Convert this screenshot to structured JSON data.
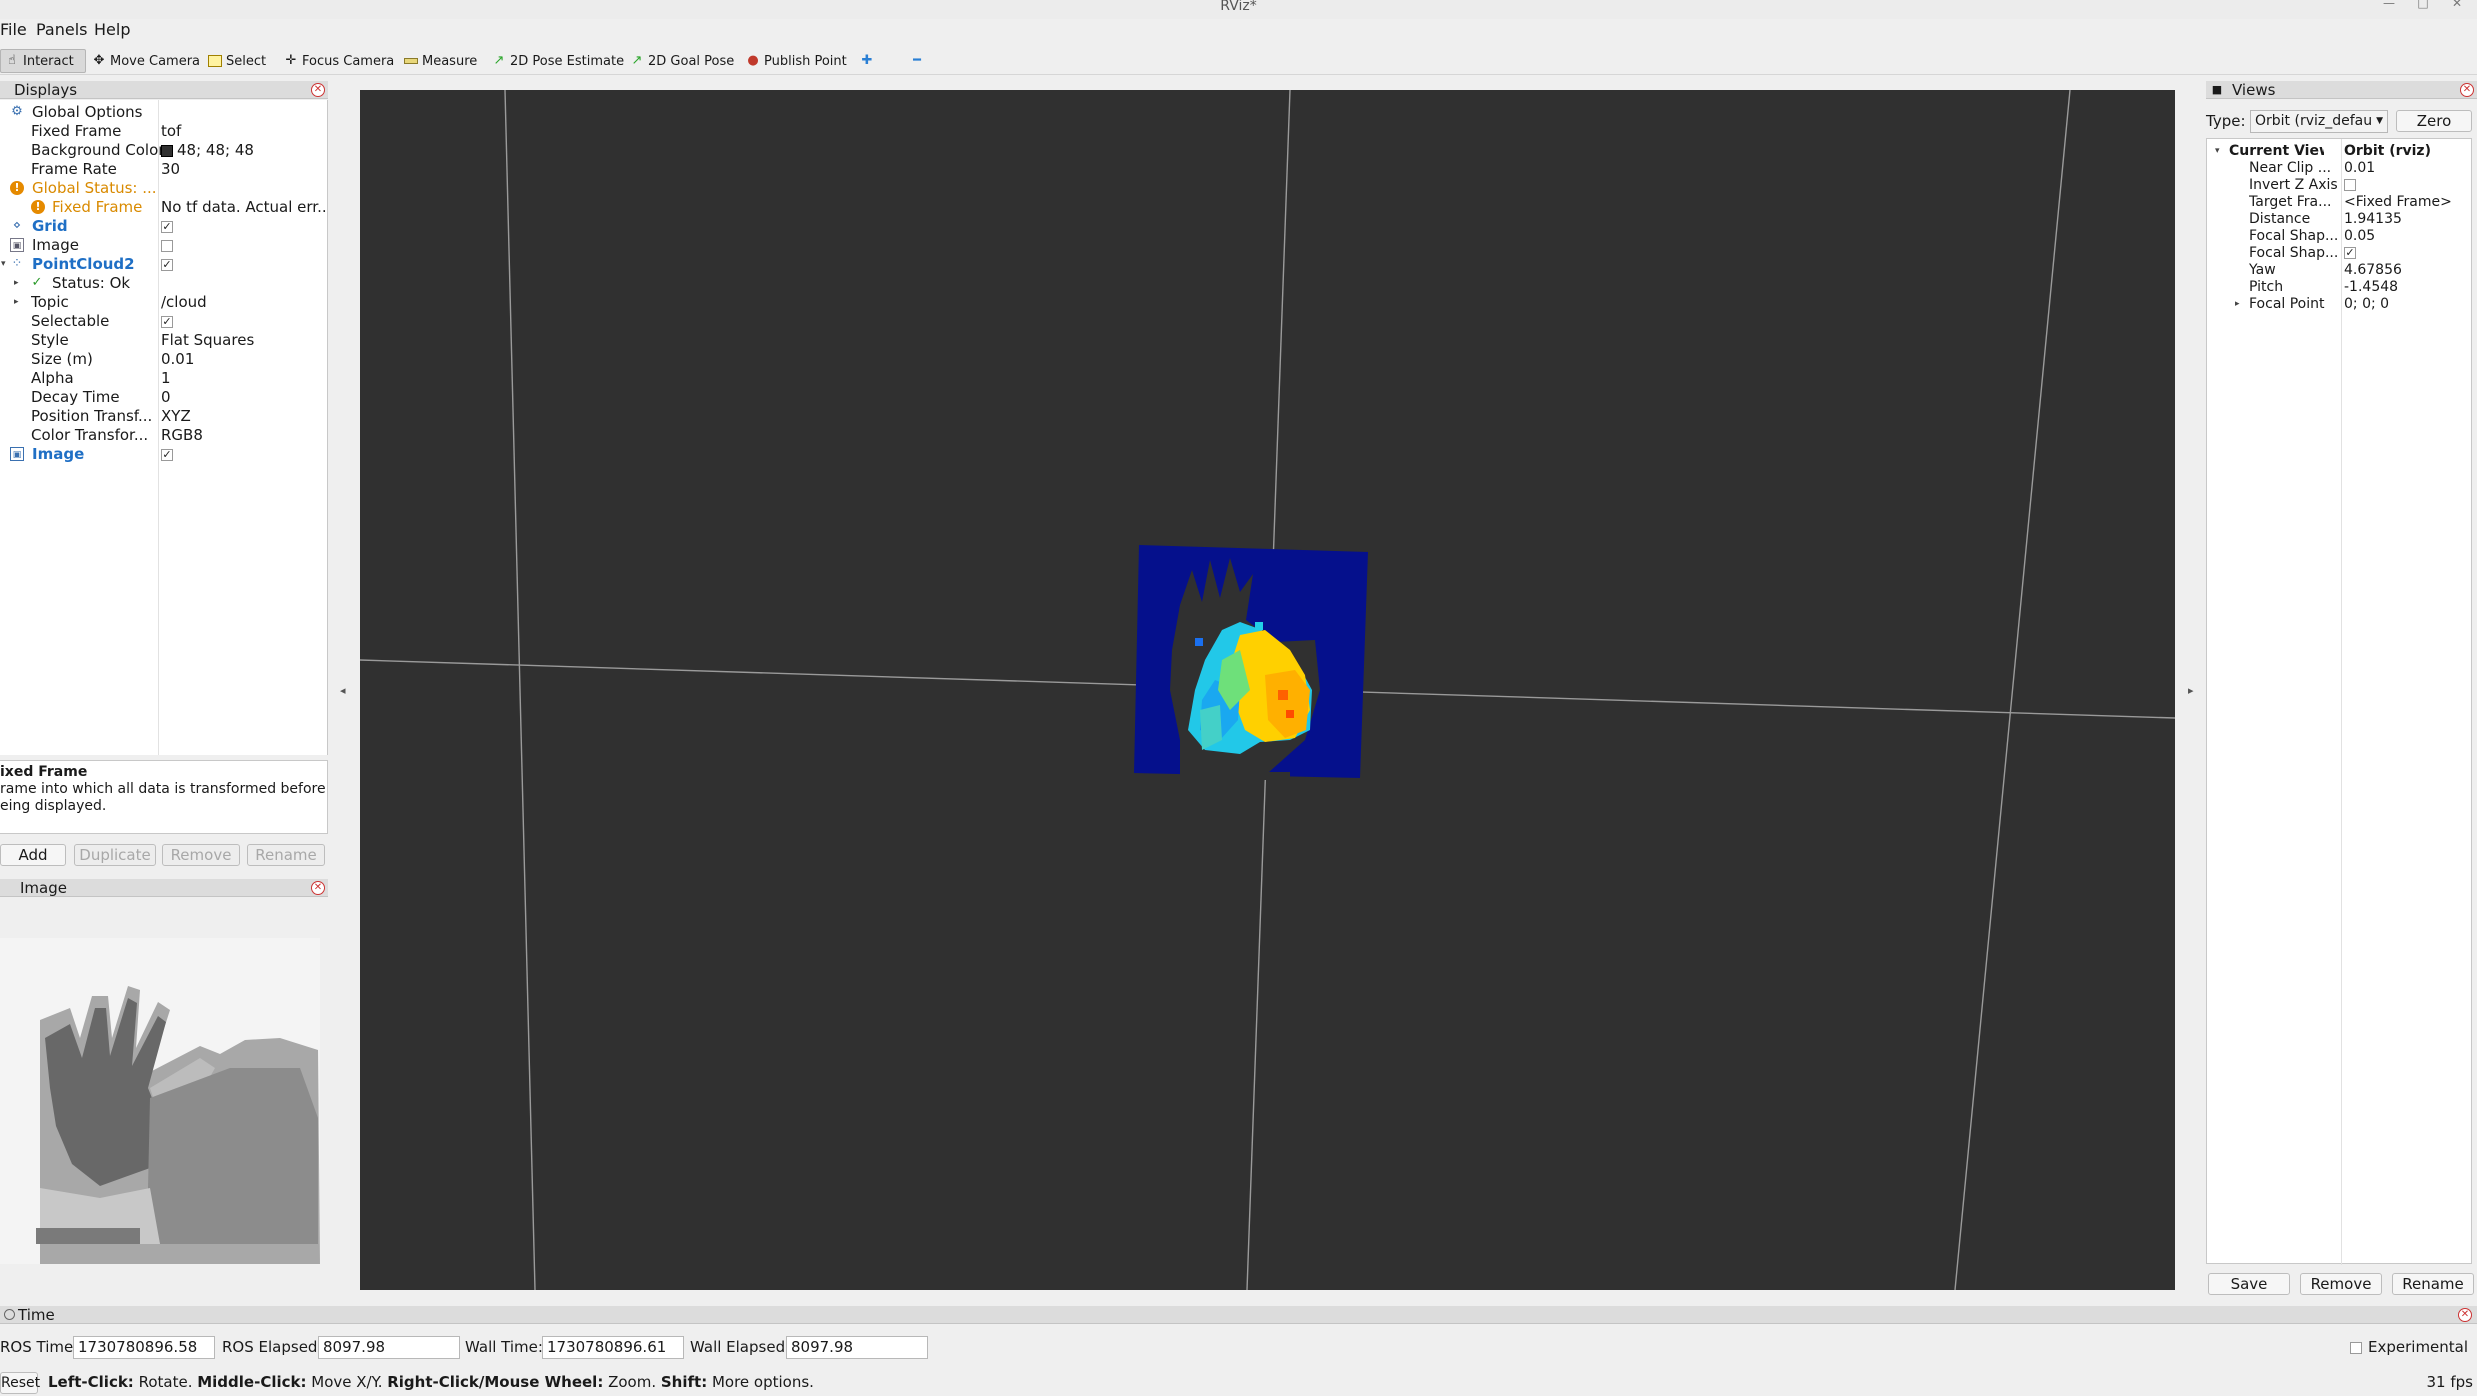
{
  "window": {
    "title": "RViz*"
  },
  "menu": {
    "file": "File",
    "panels": "Panels",
    "help": "Help"
  },
  "toolbar": {
    "interact": "Interact",
    "move_camera": "Move Camera",
    "select": "Select",
    "focus_camera": "Focus Camera",
    "measure": "Measure",
    "pose_estimate": "2D Pose Estimate",
    "goal_pose": "2D Goal Pose",
    "publish_point": "Publish Point"
  },
  "displays": {
    "title": "Displays",
    "global_options": "Global Options",
    "fixed_frame_key": "Fixed Frame",
    "fixed_frame_val": "tof",
    "bg_color_key": "Background Color",
    "bg_color_val": "48; 48; 48",
    "frame_rate_key": "Frame Rate",
    "frame_rate_val": "30",
    "global_status_key": "Global Status: ...",
    "status_fixed_frame_key": "Fixed Frame",
    "status_fixed_frame_val": "No tf data.  Actual err...",
    "grid": "Grid",
    "image1": "Image",
    "pointcloud": "PointCloud2",
    "status_ok": "Status: Ok",
    "topic_key": "Topic",
    "topic_val": "/cloud",
    "selectable_key": "Selectable",
    "style_key": "Style",
    "style_val": "Flat Squares",
    "size_key": "Size (m)",
    "size_val": "0.01",
    "alpha_key": "Alpha",
    "alpha_val": "1",
    "decay_key": "Decay Time",
    "decay_val": "0",
    "position_key": "Position Transf...",
    "position_val": "XYZ",
    "color_key": "Color Transfor...",
    "color_val": "RGB8",
    "image2": "Image",
    "desc_title": "ixed Frame",
    "desc_text_1": "rame into which all data is transformed before",
    "desc_text_2": "eing displayed.",
    "btn_add": "Add",
    "btn_duplicate": "Duplicate",
    "btn_remove": "Remove",
    "btn_rename": "Rename"
  },
  "image_panel": {
    "title": "Image"
  },
  "views": {
    "title": "Views",
    "type_label": "Type:",
    "type_value": "Orbit (rviz_defau",
    "zero": "Zero",
    "current_view_key": "Current View",
    "current_view_val": "Orbit (rviz)",
    "near_clip_key": "Near Clip ...",
    "near_clip_val": "0.01",
    "invert_z_key": "Invert Z Axis",
    "target_frame_key": "Target Fra...",
    "target_frame_val": "<Fixed Frame>",
    "distance_key": "Distance",
    "distance_val": "1.94135",
    "focal_shape1_key": "Focal Shap...",
    "focal_shape1_val": "0.05",
    "focal_shape2_key": "Focal Shap...",
    "yaw_key": "Yaw",
    "yaw_val": "4.67856",
    "pitch_key": "Pitch",
    "pitch_val": "-1.4548",
    "focal_point_key": "Focal Point",
    "focal_point_val": "0; 0; 0",
    "save": "Save",
    "remove": "Remove",
    "rename": "Rename"
  },
  "time": {
    "title": "Time",
    "ros_time_label": "ROS Time:",
    "ros_time_val": "1730780896.58",
    "ros_elapsed_label": "ROS Elapsed:",
    "ros_elapsed_val": "8097.98",
    "wall_time_label": "Wall Time:",
    "wall_time_val": "1730780896.61",
    "wall_elapsed_label": "Wall Elapsed:",
    "wall_elapsed_val": "8097.98",
    "experimental": "Experimental"
  },
  "status": {
    "reset": "Reset",
    "left_click": "Left-Click:",
    "left_click_txt": " Rotate. ",
    "middle_click": "Middle-Click:",
    "middle_click_txt": " Move X/Y. ",
    "right_click": "Right-Click/Mouse Wheel:",
    "right_click_txt": " Zoom. ",
    "shift": "Shift:",
    "shift_txt": " More options.",
    "fps": "31 fps"
  },
  "colors": {
    "render_bg": "#303030",
    "accent_blue": "#1f6fc5",
    "warning_orange": "#d98a00"
  }
}
